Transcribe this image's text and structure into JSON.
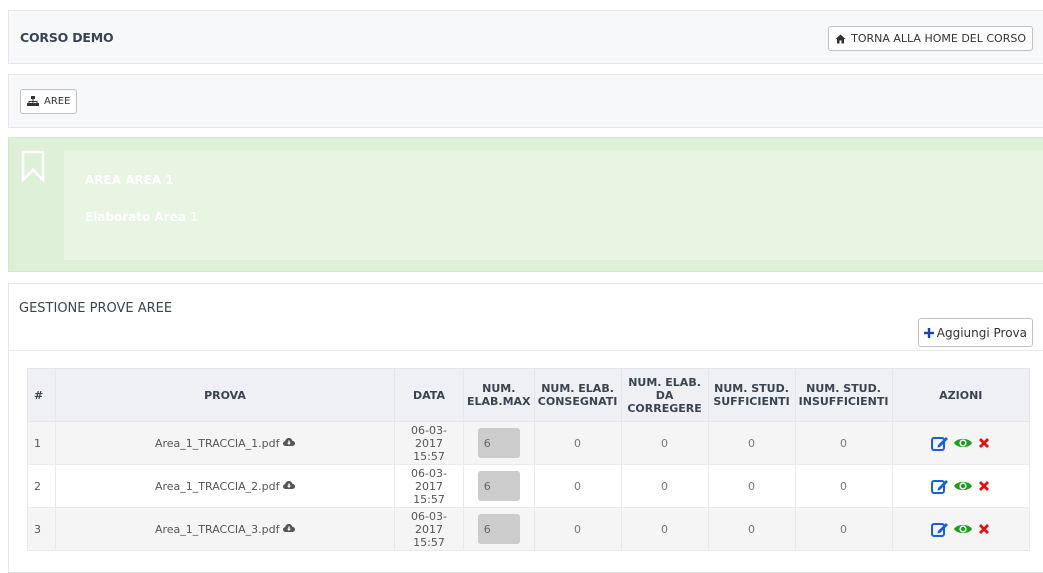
{
  "header": {
    "course_title": "CORSO DEMO",
    "home_button": "TORNA ALLA HOME DEL CORSO"
  },
  "toolbar": {
    "aree_button": "AREE"
  },
  "area": {
    "title": "AREA AREA 1",
    "subtitle": "Elaborato Area 1"
  },
  "manage": {
    "title": "GESTIONE PROVE AREE",
    "add_button": "Aggiungi Prova"
  },
  "table": {
    "columns": [
      "#",
      "PROVA",
      "DATA",
      "NUM. ELAB.MAX",
      "NUM. ELAB. CONSEGNATI",
      "NUM. ELAB. DA CORREGERE",
      "NUM. STUD. SUFFICIENTI",
      "NUM. STUD. INSUFFICIENTI",
      "AZIONI"
    ],
    "rows": [
      {
        "num": "1",
        "prova": "Area_1_TRACCIA_1.pdf",
        "date": "06-03-2017",
        "time": "15:57",
        "max": "6",
        "consegnati": "0",
        "da_correggere": "0",
        "sufficienti": "0",
        "insufficienti": "0"
      },
      {
        "num": "2",
        "prova": "Area_1_TRACCIA_2.pdf",
        "date": "06-03-2017",
        "time": "15:57",
        "max": "6",
        "consegnati": "0",
        "da_correggere": "0",
        "sufficienti": "0",
        "insufficienti": "0"
      },
      {
        "num": "3",
        "prova": "Area_1_TRACCIA_3.pdf",
        "date": "06-03-2017",
        "time": "15:57",
        "max": "6",
        "consegnati": "0",
        "da_correggere": "0",
        "sufficienti": "0",
        "insufficienti": "0"
      }
    ]
  },
  "icons": {
    "home": "home-icon",
    "aree": "sitemap-icon",
    "bookmark": "bookmark-icon",
    "add": "plus-icon",
    "download": "cloud-download-icon",
    "edit": "edit-icon",
    "view": "eye-icon",
    "delete": "delete-icon"
  },
  "colors": {
    "green_panel": "#dff0d8",
    "edit": "#1a5fd6",
    "view": "#1e9e1e",
    "delete": "#e01010",
    "add": "#1a3fb8"
  }
}
